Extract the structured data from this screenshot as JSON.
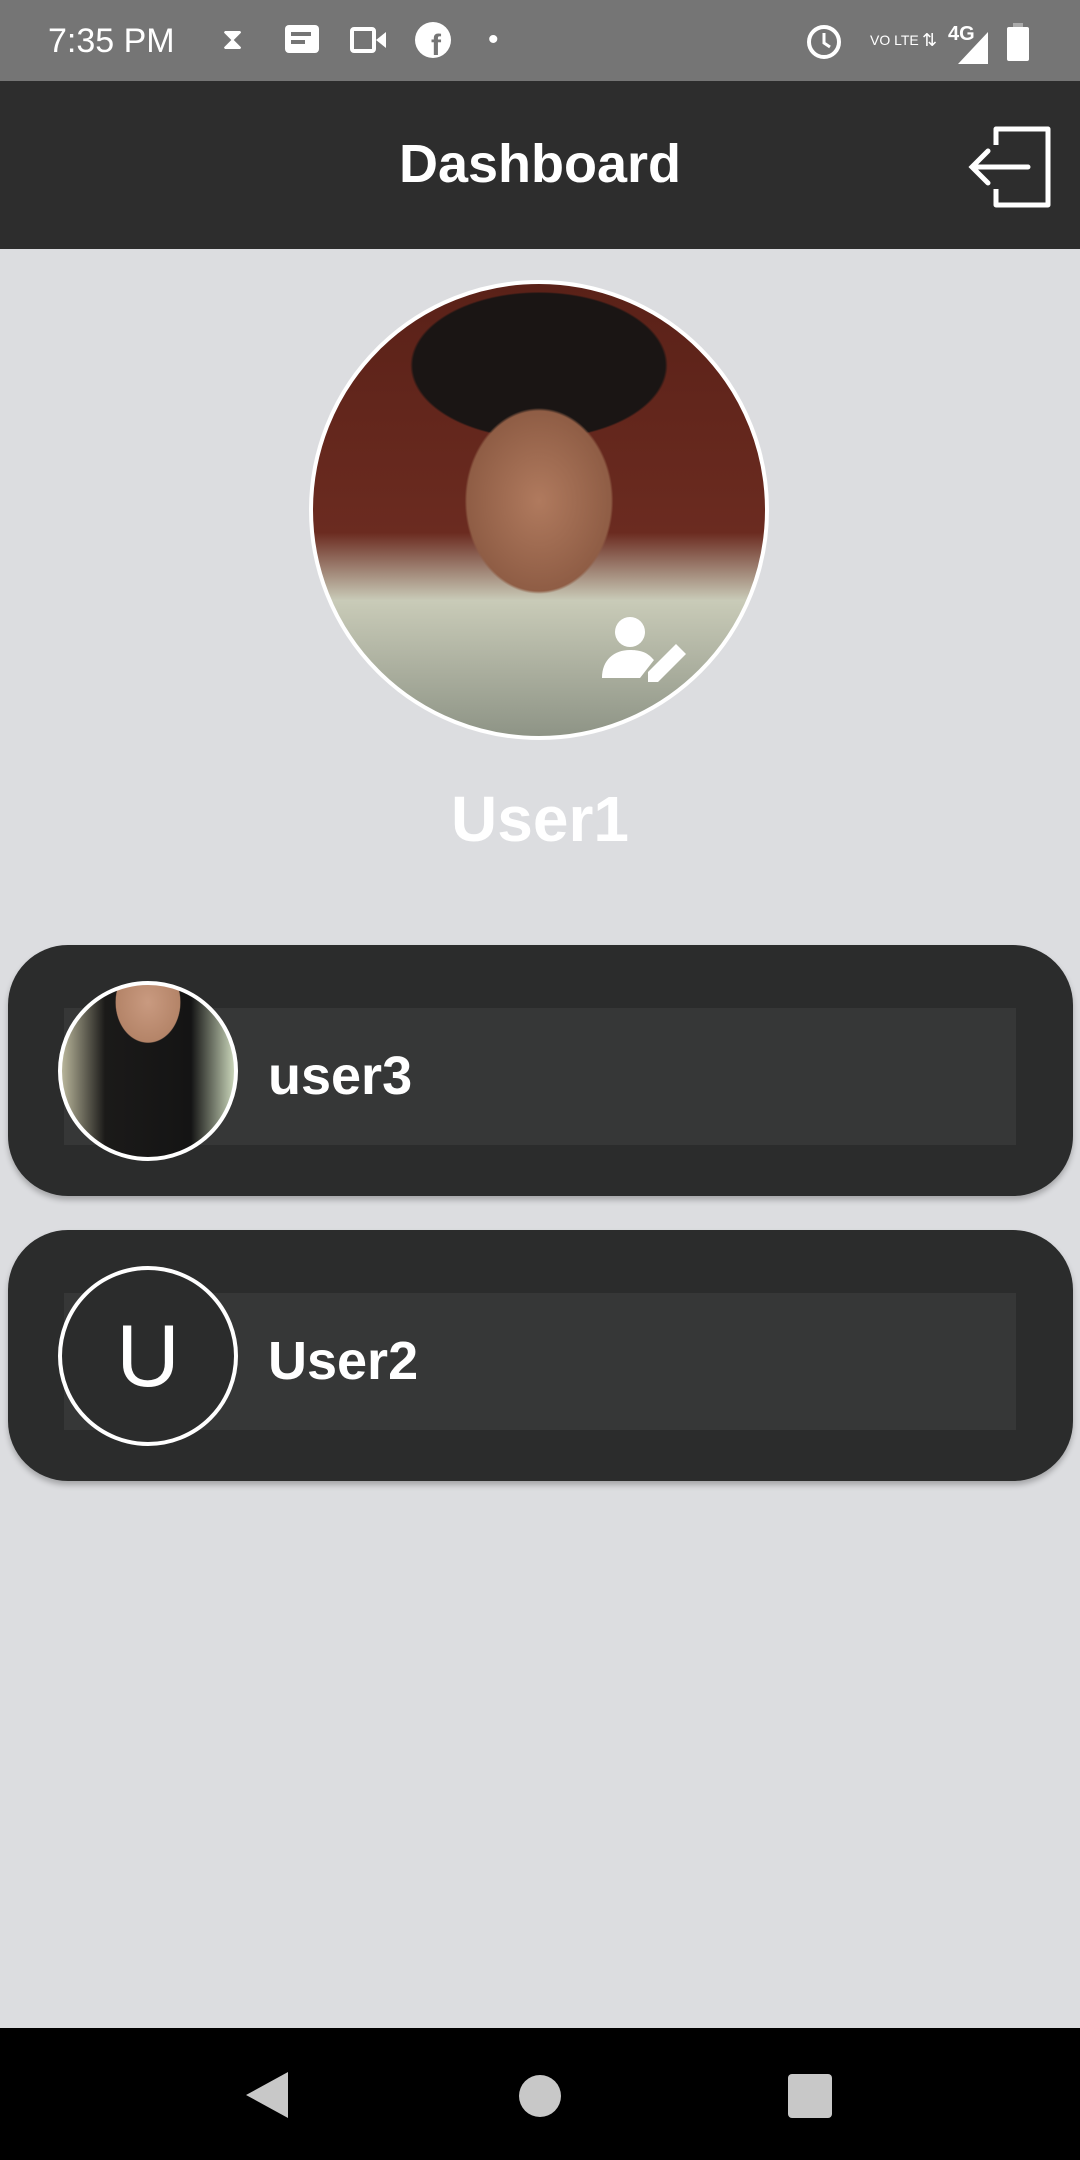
{
  "status_bar": {
    "time": "7:35 PM",
    "icons": [
      "hourglass-icon",
      "message-icon",
      "video-icon",
      "facebook-icon",
      "dot-icon",
      "alarm-icon",
      "volte-icon",
      "data-arrows-icon",
      "signal-4g-icon",
      "battery-icon"
    ],
    "network": "4G",
    "volte": "VO LTE"
  },
  "header": {
    "title": "Dashboard",
    "logout_icon": "logout-icon"
  },
  "profile": {
    "name": "User1",
    "edit_icon": "user-edit-icon"
  },
  "users": [
    {
      "name": "user3",
      "avatar": "photo"
    },
    {
      "name": "User2",
      "avatar_letter": "U"
    }
  ],
  "colors": {
    "background": "#dcdde0",
    "header": "#2d2d2d",
    "card": "#2b2c2c",
    "card_strip": "#363737",
    "status_bar": "#757575"
  }
}
